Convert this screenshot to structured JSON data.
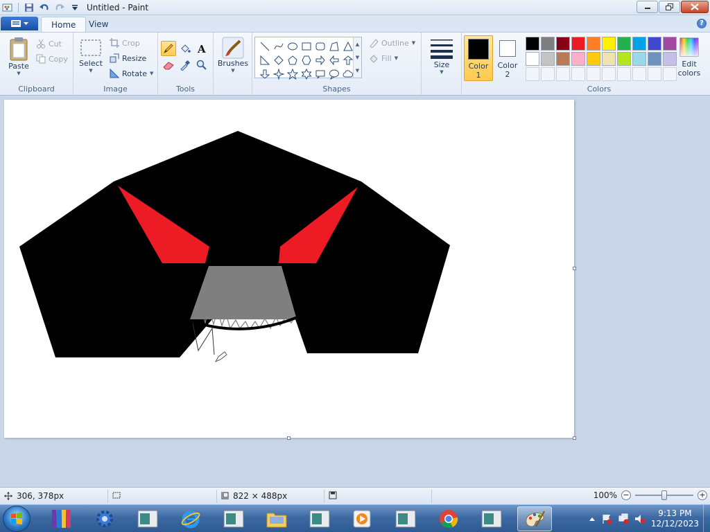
{
  "window": {
    "title": "Untitled - Paint"
  },
  "tabs": [
    {
      "label": "Home",
      "active": true
    },
    {
      "label": "View",
      "active": false
    }
  ],
  "ribbon": {
    "clipboard": {
      "label": "Clipboard",
      "paste": "Paste",
      "cut": "Cut",
      "copy": "Copy"
    },
    "image": {
      "label": "Image",
      "select": "Select",
      "crop": "Crop",
      "resize": "Resize",
      "rotate": "Rotate"
    },
    "tools": {
      "label": "Tools",
      "selected_tool": "pencil"
    },
    "brushes": {
      "label": "Brushes"
    },
    "shapes": {
      "label": "Shapes",
      "outline": "Outline",
      "fill": "Fill"
    },
    "size": {
      "label": "Size"
    },
    "color1": {
      "label": "Color",
      "num": "1",
      "value": "#000000"
    },
    "color2": {
      "label": "Color",
      "num": "2",
      "value": "#ffffff"
    },
    "colors": {
      "label": "Colors",
      "edit": "Edit colors",
      "row1": [
        "#000000",
        "#7f7f7f",
        "#880015",
        "#ed1c24",
        "#ff7f27",
        "#fff200",
        "#22b14c",
        "#00a2e8",
        "#3f48cc",
        "#a349a4"
      ],
      "row2": [
        "#ffffff",
        "#c3c3c3",
        "#b97a57",
        "#ffaec9",
        "#ffc90e",
        "#efe4b0",
        "#b5e61d",
        "#99d9ea",
        "#7092be",
        "#c8bfe7"
      ]
    }
  },
  "status": {
    "cursor": "306, 378px",
    "canvas_size": "822 × 488px",
    "zoom": "100%"
  },
  "taskbar": {
    "time": "9:13 PM",
    "date": "12/12/2023"
  }
}
